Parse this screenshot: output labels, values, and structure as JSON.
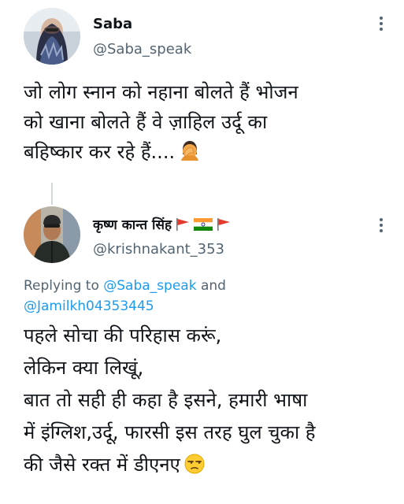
{
  "original_tweet": {
    "display_name": "Saba",
    "handle": "@Saba_speak",
    "text_lines": [
      "जो लोग स्नान को नहाना बोलते हैं भोजन",
      "को खाना बोलते हैं वे ज़ाहिल उर्दू का",
      "बहिष्कार कर रहे हैं...."
    ],
    "emoji": "face-palm"
  },
  "reply_tweet": {
    "display_name": "कृष्ण कान्त सिंह",
    "name_emojis": [
      "red-flag",
      "india-flag",
      "red-flag"
    ],
    "handle": "@krishnakant_353",
    "replying_prefix": "Replying to",
    "replying_mention_1": "@Saba_speak",
    "replying_and": "and",
    "replying_mention_2": "@Jamilkh04353445",
    "text_lines": [
      "पहले सोचा की परिहास करूं,",
      "लेकिन क्या लिखूं,",
      "बात तो सही ही कहा है इसने, हमारी भाषा",
      "में इंग्लिश,उर्दू, फारसी इस तरह घुल चुका है",
      "की जैसे रक्त में डीएनए"
    ],
    "emoji": "unamused-face"
  },
  "colors": {
    "text_primary": "#0f1419",
    "text_secondary": "#536471",
    "link": "#1d9bf0",
    "thread_line": "#cfd9de"
  }
}
